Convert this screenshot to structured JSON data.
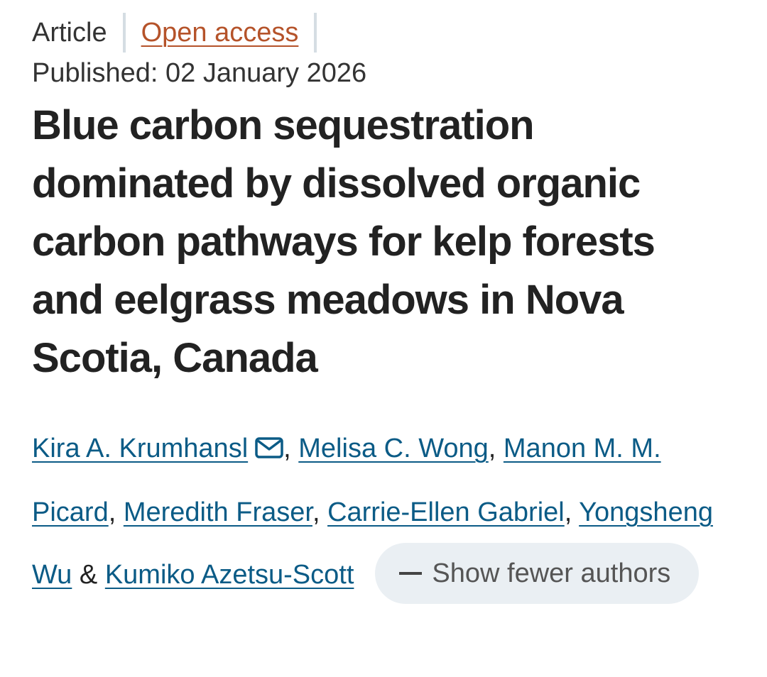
{
  "article_type": "Article",
  "open_access": "Open access",
  "published": "Published: 02 January 2026",
  "title": "Blue carbon sequestration dominated by dissolved organic carbon pathways for kelp forests and eelgrass meadows in Nova Scotia, Canada",
  "authors": [
    {
      "name": "Kira A. Krumhansl",
      "contact_icon": "mail-icon"
    },
    {
      "name": "Melisa C. Wong"
    },
    {
      "name": "Manon M. M. Picard"
    },
    {
      "name": "Meredith Fraser"
    },
    {
      "name": "Carrie-Ellen Gabriel"
    },
    {
      "name": "Yongsheng Wu"
    },
    {
      "name": "Kumiko Azetsu-Scott"
    }
  ],
  "separators": {
    "comma": ",",
    "ampersand": "&"
  },
  "show_fewer_label": "Show fewer authors",
  "colors": {
    "link": "#0b5b86",
    "open_access": "#b5532a",
    "pill_bg": "#eaeff3",
    "divider": "#d5dde3"
  }
}
